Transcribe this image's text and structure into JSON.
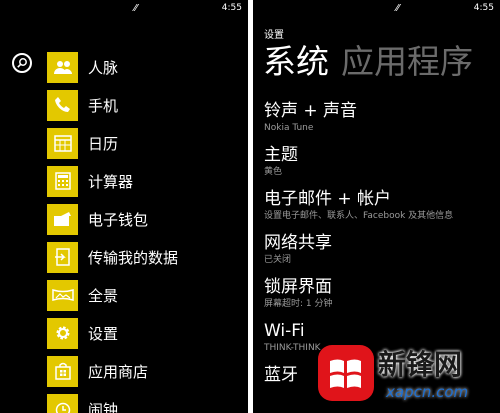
{
  "left": {
    "status": {
      "time": "4:55",
      "signal_icon": "signal-icon"
    },
    "apps": [
      {
        "label": "人脉",
        "icon": "people-icon"
      },
      {
        "label": "手机",
        "icon": "phone-icon"
      },
      {
        "label": "日历",
        "icon": "calendar-icon"
      },
      {
        "label": "计算器",
        "icon": "calculator-icon"
      },
      {
        "label": "电子钱包",
        "icon": "wallet-icon"
      },
      {
        "label": "传输我的数据",
        "icon": "transfer-icon"
      },
      {
        "label": "全景",
        "icon": "panorama-icon"
      },
      {
        "label": "设置",
        "icon": "gear-icon"
      },
      {
        "label": "应用商店",
        "icon": "store-icon"
      },
      {
        "label": "闹钟",
        "icon": "alarm-icon"
      }
    ],
    "tile_color": "#e3c800"
  },
  "right": {
    "status": {
      "time": "4:55"
    },
    "header": "设置",
    "pivots": {
      "active": "系统",
      "inactive": "应用程序"
    },
    "settings": [
      {
        "title": "铃声 + 声音",
        "sub": "Nokia Tune"
      },
      {
        "title": "主题",
        "sub": "黄色"
      },
      {
        "title": "电子邮件 + 帐户",
        "sub": "设置电子邮件、联系人、Facebook 及其他信息"
      },
      {
        "title": "网络共享",
        "sub": "已关闭"
      },
      {
        "title": "锁屏界面",
        "sub": "屏幕超时: 1 分钟"
      },
      {
        "title": "Wi-Fi",
        "sub": "THINK-THINK"
      },
      {
        "title": "蓝牙",
        "sub": ""
      }
    ]
  },
  "watermark": {
    "text": "新锋网",
    "url": "xapcn.com"
  }
}
